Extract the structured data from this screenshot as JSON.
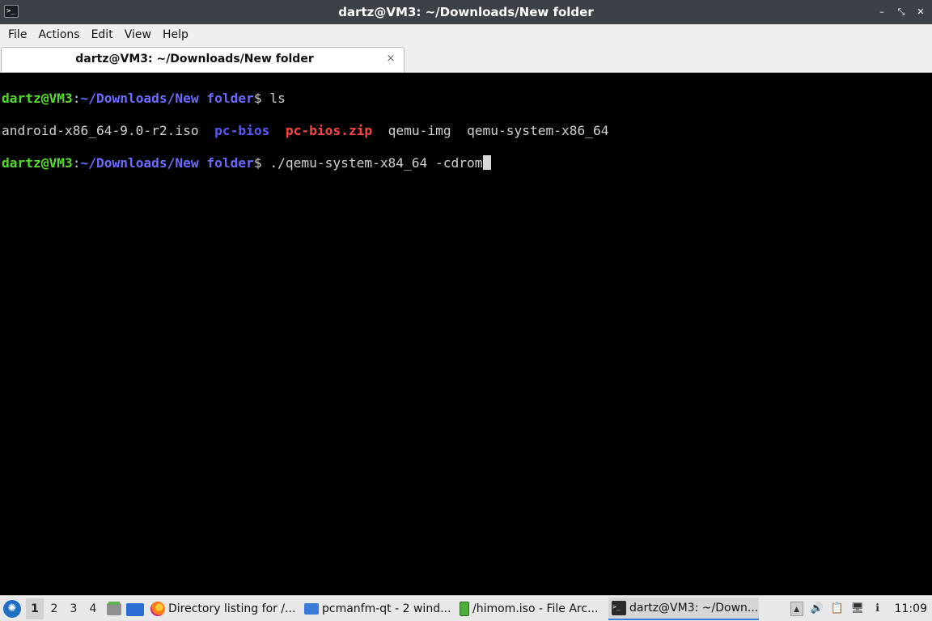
{
  "window": {
    "title": "dartz@VM3: ~/Downloads/New folder",
    "icon": "terminal-icon"
  },
  "menu": [
    "File",
    "Actions",
    "Edit",
    "View",
    "Help"
  ],
  "tab": {
    "label": "dartz@VM3: ~/Downloads/New folder",
    "close_glyph": "×"
  },
  "terminal": {
    "prompt_user": "dartz@VM3",
    "prompt_sep": ":",
    "prompt_path": "~/Downloads/New folder",
    "prompt_symbol": "$ ",
    "cmd1": "ls",
    "listing": {
      "file1": "android-x86_64-9.0-r2.iso",
      "dir1": "pc-bios",
      "zip1": "pc-bios.zip",
      "file2": "qemu-img",
      "file3": "qemu-system-x86_64"
    },
    "cmd2": "./qemu-system-x84_64 -cdrom",
    "colors": {
      "user": "#55dd2a",
      "path": "#6b6bff",
      "directory": "#5a5aff",
      "archive": "#ff4444",
      "background": "#000000"
    }
  },
  "taskbar": {
    "desktops": [
      "1",
      "2",
      "3",
      "4"
    ],
    "active_desktop": "1",
    "tasks": [
      {
        "label": "Directory listing for /...",
        "icon": "firefox-icon"
      },
      {
        "label": "pcmanfm-qt - 2 wind...",
        "icon": "folder-icon"
      },
      {
        "label": "/himom.iso - File Arc...",
        "icon": "archive-icon"
      },
      {
        "label": "dartz@VM3: ~/Down...",
        "icon": "terminal-icon"
      }
    ],
    "clock": "11:09"
  }
}
